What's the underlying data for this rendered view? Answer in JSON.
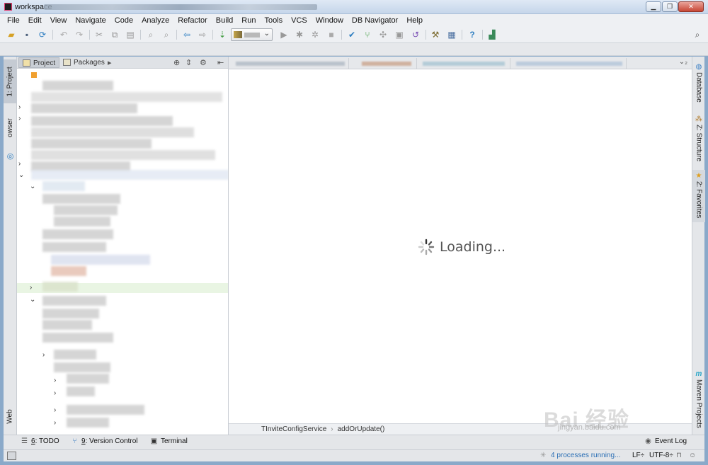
{
  "window": {
    "title": "workspace"
  },
  "menu": [
    "File",
    "Edit",
    "View",
    "Navigate",
    "Code",
    "Analyze",
    "Refactor",
    "Build",
    "Run",
    "Tools",
    "VCS",
    "Window",
    "DB Navigator",
    "Help"
  ],
  "left_stripe": {
    "tabs": [
      "1: Project",
      "owser",
      "Web"
    ]
  },
  "right_stripe": {
    "tabs": [
      "Database",
      "Z: Structure",
      "2: Favorites",
      "Maven Projects"
    ]
  },
  "project_panel": {
    "tabs": [
      "Project",
      "Packages"
    ]
  },
  "editor": {
    "loading_text": "Loading..."
  },
  "breadcrumb": [
    "TInviteConfigService",
    "addOrUpdate()"
  ],
  "bottom_tools": [
    {
      "key": "6",
      "label": ": TODO",
      "icon": "todo-icon"
    },
    {
      "key": "9",
      "label": ": Version Control",
      "icon": "version-control-icon"
    },
    {
      "key": "",
      "label": "Terminal",
      "icon": "terminal-icon"
    },
    {
      "key": "",
      "label": "Event Log",
      "icon": "event-log-icon"
    }
  ],
  "status": {
    "processes": "4 processes running...",
    "line_separator": "LF÷",
    "encoding": "UTF-8÷"
  },
  "watermark": {
    "brand": "Bai 经验",
    "sub": "jingyan.baidu.com"
  },
  "colors": {
    "accent": "#2b6fb5",
    "selection": "#e9f5e3",
    "window_frame": "#8aa9c9"
  }
}
